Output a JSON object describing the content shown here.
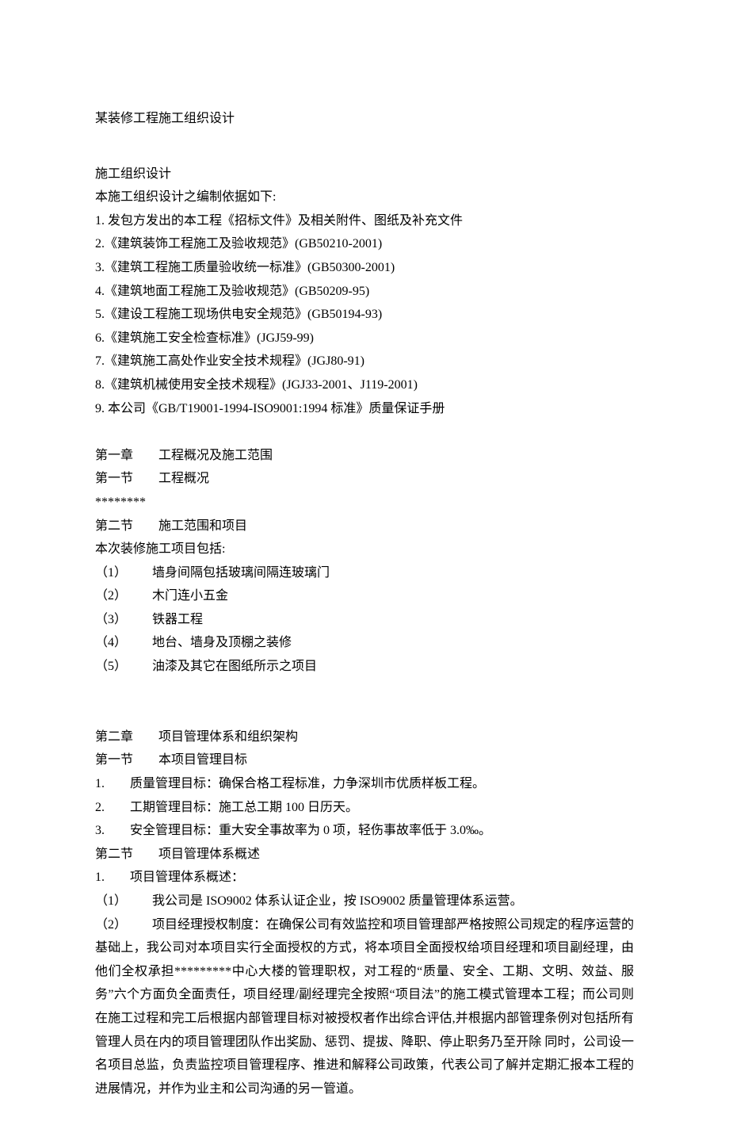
{
  "docTitle": "某装修工程施工组织设计",
  "introHeader": "施工组织设计",
  "introLine": "本施工组织设计之编制依据如下:",
  "basis": [
    "1.   发包方发出的本工程《招标文件》及相关附件、图纸及补充文件",
    "2.《建筑装饰工程施工及验收规范》(GB50210-2001)",
    "3.《建筑工程施工质量验收统一标准》(GB50300-2001)",
    "4.《建筑地面工程施工及验收规范》(GB50209-95)",
    "5.《建设工程施工现场供电安全规范》(GB50194-93)",
    "6.《建筑施工安全检查标准》(JGJ59-99)",
    "7.《建筑施工高处作业安全技术规程》(JGJ80-91)",
    "8.《建筑机械使用安全技术规程》(JGJ33-2001、J119-2001)",
    "9.   本公司《GB/T19001-1994-ISO9001:1994 标准》质量保证手册"
  ],
  "ch1": {
    "title": "第一章  工程概况及施工范围",
    "s1": {
      "title": "第一节  工程概况",
      "body": "********"
    },
    "s2": {
      "title": "第二节  施工范围和项目",
      "intro": "本次装修施工项目包括:",
      "items": [
        "（1）  墙身间隔包括玻璃间隔连玻璃门",
        "（2）  木门连小五金",
        "（3）  铁器工程",
        "（4）  地台、墙身及顶棚之装修",
        "（5）  油漆及其它在图纸所示之项目"
      ]
    }
  },
  "ch2": {
    "title": "第二章  项目管理体系和组织架构",
    "s1": {
      "title": "第一节  本项目管理目标",
      "items": [
        "1.  质量管理目标：确保合格工程标准，力争深圳市优质样板工程。",
        "2.  工期管理目标：施工总工期 100 日历天。",
        "3.  安全管理目标：重大安全事故率为 0 项，轻伤事故率低于 3.0‰。"
      ]
    },
    "s2": {
      "title": "第二节  项目管理体系概述",
      "lead": "1.  项目管理体系概述：",
      "p1": "（1）  我公司是 ISO9002 体系认证企业，按 ISO9002 质量管理体系运营。",
      "p2": "（2）  项目经理授权制度：在确保公司有效监控和项目管理部严格按照公司规定的程序运营的基础上，我公司对本项目实行全面授权的方式，将本项目全面授权给项目经理和项目副经理，由他们全权承担*********中心大楼的管理职权，对工程的“质量、安全、工期、文明、效益、服务”六个方面负全面责任，项目经理/副经理完全按照“项目法”的施工模式管理本工程；而公司则在施工过程和完工后根据内部管理目标对被授权者作出综合评估,并根据内部管理条例对包括所有管理人员在内的项目管理团队作出奖励、惩罚、提拔、降职、停止职务乃至开除  同时，公司设一名项目总监，负责监控项目管理程序、推进和解释公司政策，代表公司了解并定期汇报本工程的进展情况，并作为业主和公司沟通的另一管道。"
    }
  }
}
